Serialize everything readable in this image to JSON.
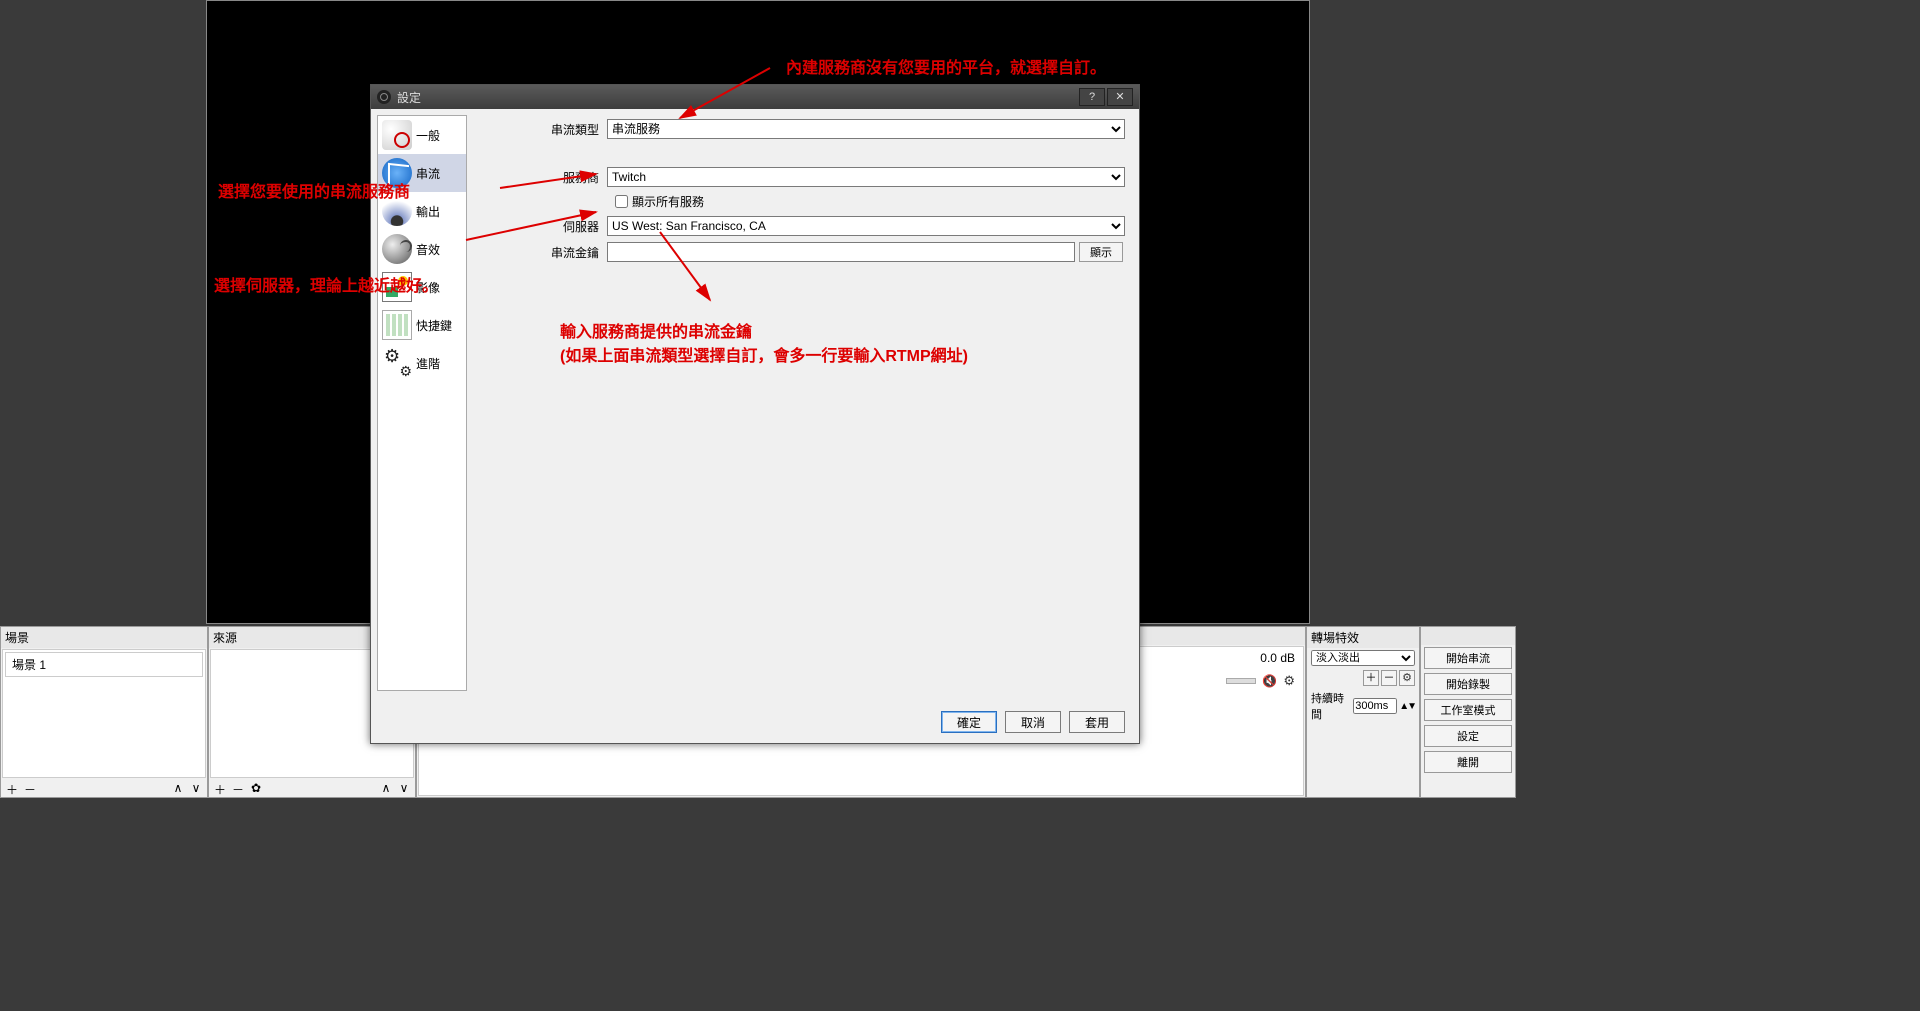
{
  "docks": {
    "scenes": {
      "title": "場景",
      "items": [
        "場景 1"
      ]
    },
    "sources": {
      "title": "來源"
    },
    "transitions": {
      "title": "轉場特效",
      "select": "淡入淡出",
      "duration_label": "持續時間",
      "duration_value": "300ms"
    },
    "controls": {
      "buttons": [
        "開始串流",
        "開始錄製",
        "工作室模式",
        "設定",
        "離開"
      ]
    },
    "mixer": {
      "db": "0.0 dB"
    }
  },
  "foot": {
    "plus": "＋",
    "minus": "－",
    "up": "∧",
    "down": "∨",
    "gear": "✿"
  },
  "dialog": {
    "title": "設定",
    "help": "?",
    "close": "✕",
    "sidebar": [
      "一般",
      "串流",
      "輸出",
      "音效",
      "影像",
      "快捷鍵",
      "進階"
    ],
    "active_index": 1,
    "form": {
      "stream_type_label": "串流類型",
      "stream_type_value": "串流服務",
      "service_label": "服務商",
      "service_value": "Twitch",
      "show_all_label": "顯示所有服務",
      "server_label": "伺服器",
      "server_value": "US West: San Francisco, CA",
      "key_label": "串流金鑰",
      "key_value": "",
      "show_btn": "顯示"
    },
    "buttons": {
      "ok": "確定",
      "cancel": "取消",
      "apply": "套用"
    }
  },
  "annotations": {
    "a1": "內建服務商沒有您要用的平台，就選擇自訂。",
    "a2": "選擇您要使用的串流服務商",
    "a3": "選擇伺服器，理論上越近越好。",
    "a4_l1": "輸入服務商提供的串流金鑰",
    "a4_l2": "(如果上面串流類型選擇自訂，會多一行要輸入RTMP網址)"
  }
}
